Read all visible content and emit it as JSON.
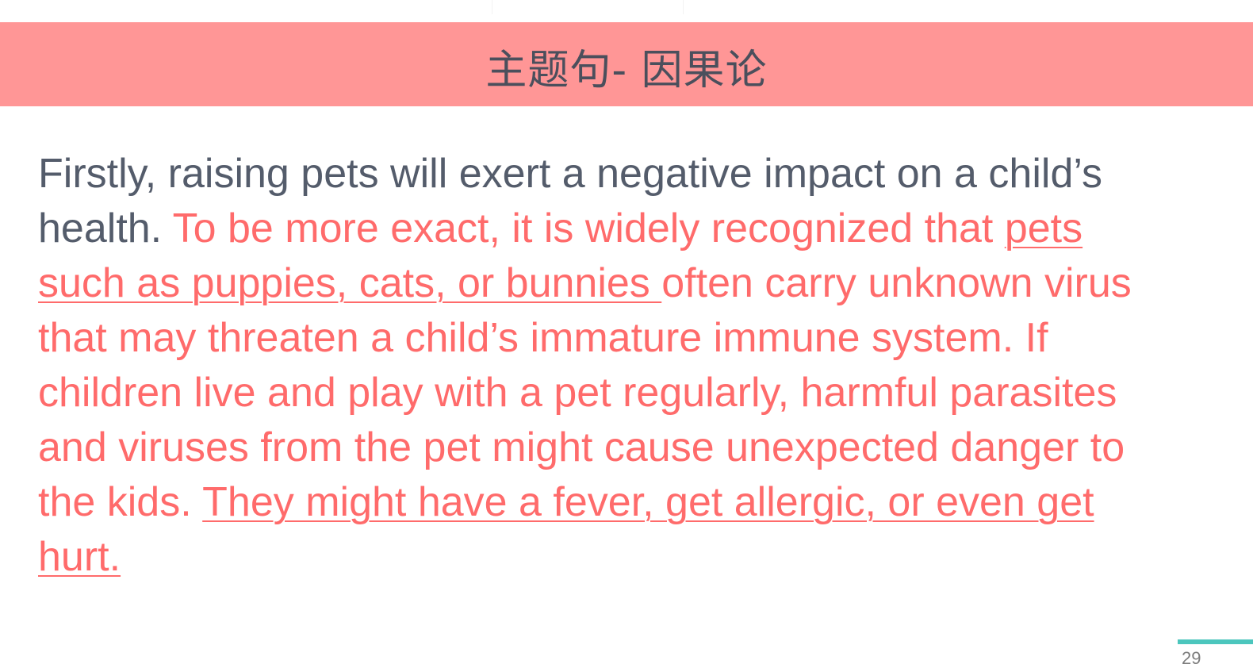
{
  "slide": {
    "title": "主题句- 因果论",
    "page_number": "29",
    "accent_color": "#ff9696",
    "highlight_color": "#ff6b6b",
    "footer_color": "#4cc6bd"
  },
  "paragraph": {
    "seg1": "Firstly, raising pets will exert a negative impact on a child’s health. ",
    "seg2": "To be more exact, it is widely recognized that ",
    "seg3": "pets such as puppies, cats, or bunnies ",
    "seg4": "often carry unknown virus that may threaten a child’s immature immune system. If children live and play with a pet regularly, harmful parasites and viruses from the pet might cause unexpected danger to the kids. ",
    "seg5": "They might have a fever, get allergic, or even get hurt."
  }
}
